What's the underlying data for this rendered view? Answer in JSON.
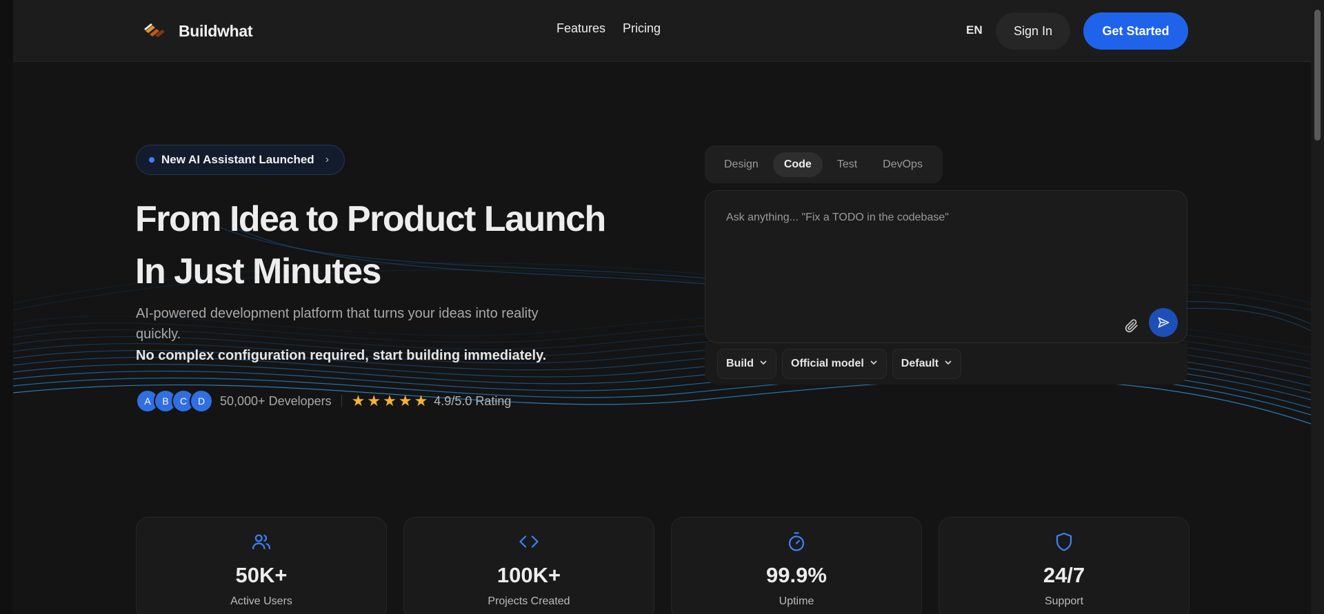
{
  "nav": {
    "brand": "Buildwhat",
    "links": [
      "Features",
      "Pricing"
    ],
    "language": "EN",
    "sign_in": "Sign In",
    "get_started": "Get Started"
  },
  "hero": {
    "badge": "New AI Assistant Launched",
    "headline_line1": "From Idea to Product Launch",
    "headline_line2": "In Just Minutes",
    "subtitle": "AI-powered development platform that turns your ideas into reality quickly.",
    "subtitle_strong": "No complex configuration required, start building immediately.",
    "avatars": [
      "A",
      "B",
      "C",
      "D"
    ],
    "developers": "50,000+ Developers",
    "rating_stars": 5,
    "rating": "4.9/5.0 Rating"
  },
  "prompt": {
    "tabs": [
      "Design",
      "Code",
      "Test",
      "DevOps"
    ],
    "active_tab": "Code",
    "placeholder": "Ask anything... \"Fix a TODO in the codebase\"",
    "options": [
      "Build",
      "Official model",
      "Default"
    ]
  },
  "stats": [
    {
      "icon": "users-icon",
      "value": "50K+",
      "label": "Active Users"
    },
    {
      "icon": "code-icon",
      "value": "100K+",
      "label": "Projects Created"
    },
    {
      "icon": "stopwatch-icon",
      "value": "99.9%",
      "label": "Uptime"
    },
    {
      "icon": "shield-icon",
      "value": "24/7",
      "label": "Support"
    }
  ],
  "colors": {
    "background": "#141414",
    "accent": "#1f63ea",
    "icon_accent": "#3b82f6",
    "star": "#f5b52a"
  }
}
